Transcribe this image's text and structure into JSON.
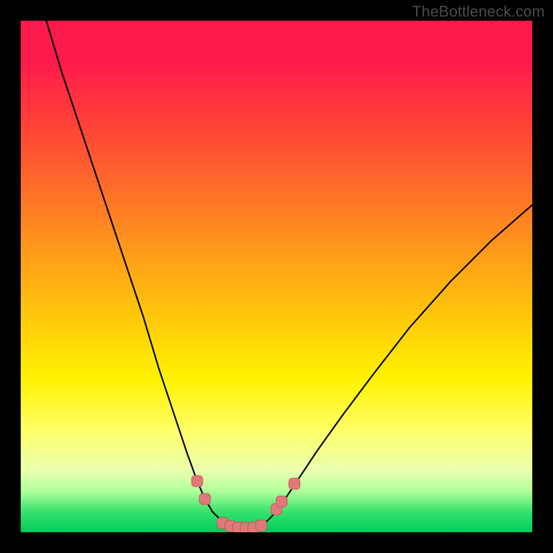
{
  "watermark": "TheBottleneck.com",
  "chart_data": {
    "type": "line",
    "title": "",
    "xlabel": "",
    "ylabel": "",
    "xlim": [
      0,
      100
    ],
    "ylim": [
      0,
      100
    ],
    "background_gradient": {
      "orientation": "vertical",
      "stops": [
        {
          "pos": 0,
          "color": "#ff1a4d"
        },
        {
          "pos": 18,
          "color": "#ff3a3a"
        },
        {
          "pos": 45,
          "color": "#ff9a1a"
        },
        {
          "pos": 70,
          "color": "#fff200"
        },
        {
          "pos": 88,
          "color": "#eaffb0"
        },
        {
          "pos": 96,
          "color": "#35e26b"
        },
        {
          "pos": 100,
          "color": "#00cc5c"
        }
      ]
    },
    "series": [
      {
        "name": "left-branch",
        "x": [
          5,
          8,
          12,
          16,
          20,
          24,
          27,
          30,
          32.5,
          34.5,
          36,
          37.5,
          39,
          40.5
        ],
        "y": [
          100,
          90,
          78,
          66,
          54,
          42,
          32,
          23,
          15.5,
          10,
          6.5,
          4,
          2.5,
          1.5
        ]
      },
      {
        "name": "valley-floor",
        "x": [
          40.5,
          42,
          44,
          46,
          47.5
        ],
        "y": [
          1.5,
          0.9,
          0.8,
          1.0,
          1.6
        ]
      },
      {
        "name": "right-branch",
        "x": [
          47.5,
          49,
          51,
          54,
          58,
          63,
          69,
          76,
          84,
          92,
          100
        ],
        "y": [
          1.6,
          3,
          5.5,
          10,
          16,
          23,
          31,
          40,
          49,
          57,
          64
        ]
      }
    ],
    "markers": {
      "name": "highlight-points",
      "shape": "rounded-square",
      "color": "#e07a7a",
      "points": [
        {
          "x": 34.5,
          "y": 10.0
        },
        {
          "x": 36.0,
          "y": 6.5
        },
        {
          "x": 39.5,
          "y": 1.8
        },
        {
          "x": 41.0,
          "y": 1.2
        },
        {
          "x": 42.5,
          "y": 0.9
        },
        {
          "x": 44.0,
          "y": 0.8
        },
        {
          "x": 45.5,
          "y": 0.9
        },
        {
          "x": 47.0,
          "y": 1.3
        },
        {
          "x": 50.0,
          "y": 4.5
        },
        {
          "x": 51.0,
          "y": 6.0
        },
        {
          "x": 53.5,
          "y": 9.5
        }
      ]
    }
  }
}
